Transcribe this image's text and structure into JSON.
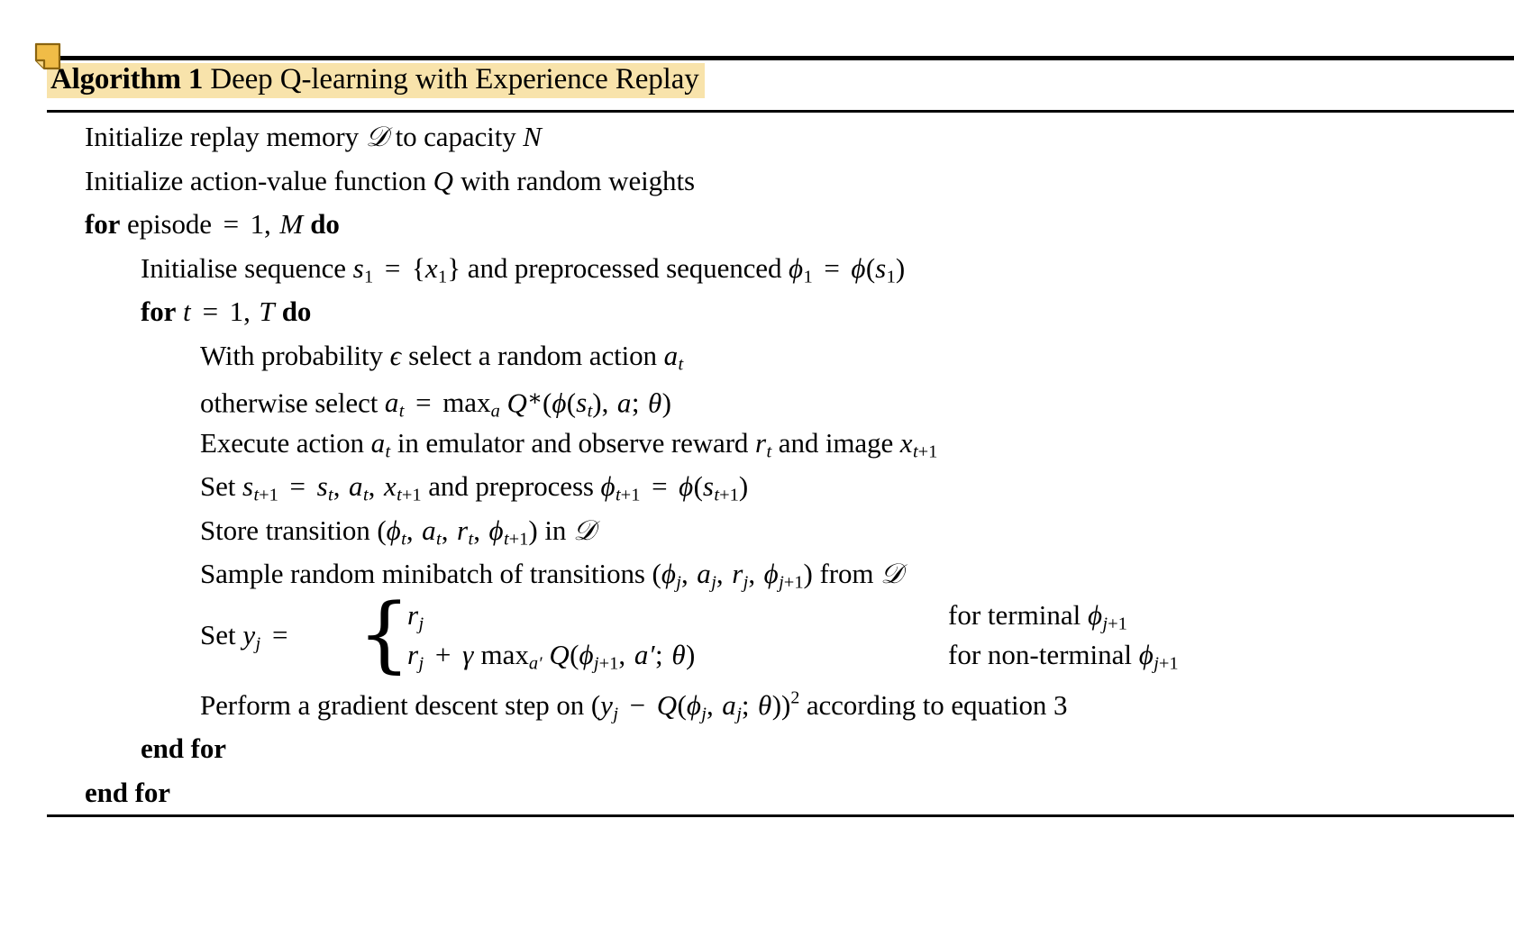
{
  "document": {
    "kind": "pdf-algorithm-float",
    "background_color": "#ffffff"
  },
  "annotations": {
    "sticky_note": {
      "icon": "sticky-note-icon",
      "fill_color": "#f0bc47",
      "border_color": "#8a6410"
    },
    "highlight": {
      "color": "#f8e3ab",
      "target": "algorithm-title"
    },
    "red_box": {
      "color": "#e81d0e",
      "target": "equation-reference",
      "clipped": true
    }
  },
  "algorithm": {
    "label": "Algorithm 1",
    "name": "Deep Q-learning with Experience Replay",
    "lines": [
      {
        "id": "init-replay-memory",
        "indent": 0,
        "text": "Initialize replay memory D to capacity N"
      },
      {
        "id": "init-action-value",
        "indent": 0,
        "text": "Initialize action-value function Q with random weights"
      },
      {
        "id": "for-episode",
        "indent": 0,
        "text": "for episode = 1, M do"
      },
      {
        "id": "init-sequence",
        "indent": 1,
        "text": "Initialise sequence s1 = {x1} and preprocessed sequenced phi1 = phi(s1)"
      },
      {
        "id": "for-t",
        "indent": 1,
        "text": "for t = 1, T do"
      },
      {
        "id": "epsilon-random",
        "indent": 2,
        "text": "With probability epsilon select a random action at"
      },
      {
        "id": "otherwise-select",
        "indent": 2,
        "text": "otherwise select at = max_a Q*(phi(st), a; theta)"
      },
      {
        "id": "execute-action",
        "indent": 2,
        "text": "Execute action at in emulator and observe reward rt and image xt+1"
      },
      {
        "id": "set-state",
        "indent": 2,
        "text": "Set st+1 = st, at, xt+1 and preprocess phit+1 = phi(st+1)"
      },
      {
        "id": "store-transition",
        "indent": 2,
        "text": "Store transition (phit, at, rt, phit+1) in D"
      },
      {
        "id": "sample-minibatch",
        "indent": 2,
        "text": "Sample random minibatch of transitions (phij, aj, rj, phij+1) from D"
      },
      {
        "id": "set-y-cases",
        "indent": 2,
        "text": "Set yj = { rj for terminal phij+1 ; rj + gamma max_a' Q(phij+1, a'; theta) for non-terminal phij+1 }"
      },
      {
        "id": "gradient-descent",
        "indent": 2,
        "text": "Perform a gradient descent step on (yj - Q(phij, aj; theta))^2 according to equation 3"
      },
      {
        "id": "end-for-inner",
        "indent": 1,
        "text": "end for"
      },
      {
        "id": "end-for-outer",
        "indent": 0,
        "text": "end for"
      }
    ],
    "keywords": {
      "for": "for",
      "do": "do",
      "end_for": "end for"
    },
    "cases": {
      "set_label": "Set",
      "case1_value": "rj",
      "case1_condition": "for terminal",
      "case2_value": "rj + gamma max_a' Q(phij+1, a'; theta)",
      "case2_condition": "for non-terminal"
    },
    "equation_reference": "3"
  },
  "symbols": {
    "D": "D",
    "N": "N",
    "Q": "Q",
    "M": "M",
    "T": "T",
    "t": "t",
    "s": "s",
    "x": "x",
    "a": "a",
    "r": "r",
    "y": "y",
    "j": "j",
    "phi": "ϕ",
    "epsilon": "ϵ",
    "theta": "θ",
    "gamma": "γ",
    "max": "max",
    "eq": "=",
    "plus": "+",
    "minus": "−",
    "comma": ",",
    "semicolon": ";",
    "star": "∗",
    "prime": "′",
    "lbrace": "{",
    "rbrace": "}",
    "one": "1",
    "two": "2",
    "three": "3"
  }
}
